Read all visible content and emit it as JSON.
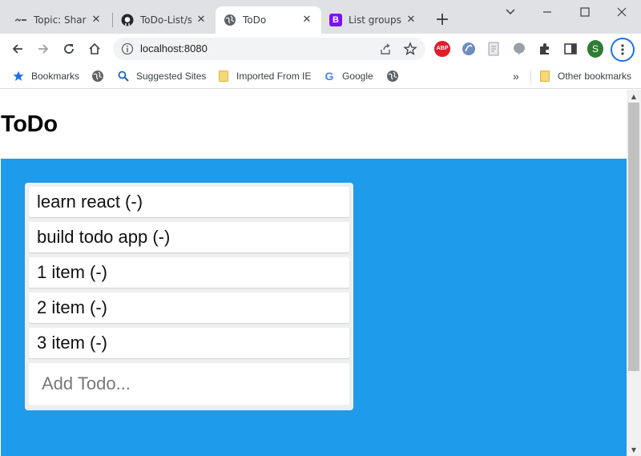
{
  "browser": {
    "tabs": [
      {
        "title": "Topic: Share",
        "icon": "article-favicon-icon",
        "active": false
      },
      {
        "title": "ToDo-List/st",
        "icon": "github-icon",
        "active": false
      },
      {
        "title": "ToDo",
        "icon": "globe-icon",
        "active": true
      },
      {
        "title": "List groups",
        "icon": "bootstrap-icon",
        "active": false,
        "badge": "B"
      }
    ],
    "new_tab_label": "+",
    "address": "localhost:8080",
    "profile_initial": "S",
    "extensions": {
      "abp_label": "ABP"
    },
    "bookmarks": [
      {
        "label": "Bookmarks",
        "icon": "star-icon"
      },
      {
        "label": "",
        "icon": "globe-icon"
      },
      {
        "label": "Suggested Sites",
        "icon": "search-icon"
      },
      {
        "label": "Imported From IE",
        "icon": "folder-icon"
      },
      {
        "label": "Google",
        "icon": "google-icon"
      },
      {
        "label": "",
        "icon": "globe-icon"
      }
    ],
    "overflow_label": "»",
    "other_bookmarks": "Other bookmarks"
  },
  "page": {
    "title": "ToDo",
    "todos": [
      {
        "text": "learn react (-)"
      },
      {
        "text": "build todo app (-)"
      },
      {
        "text": "1 item (-)"
      },
      {
        "text": "2 item (-)"
      },
      {
        "text": "3 item (-)"
      }
    ],
    "add_placeholder": "Add Todo...",
    "add_value": ""
  },
  "colors": {
    "accent": "#1e9bea",
    "card_bg": "#efefef",
    "tabstrip_bg": "#dfe1e5",
    "profile": "#2e7d32",
    "bootstrap": "#7b11f5"
  }
}
